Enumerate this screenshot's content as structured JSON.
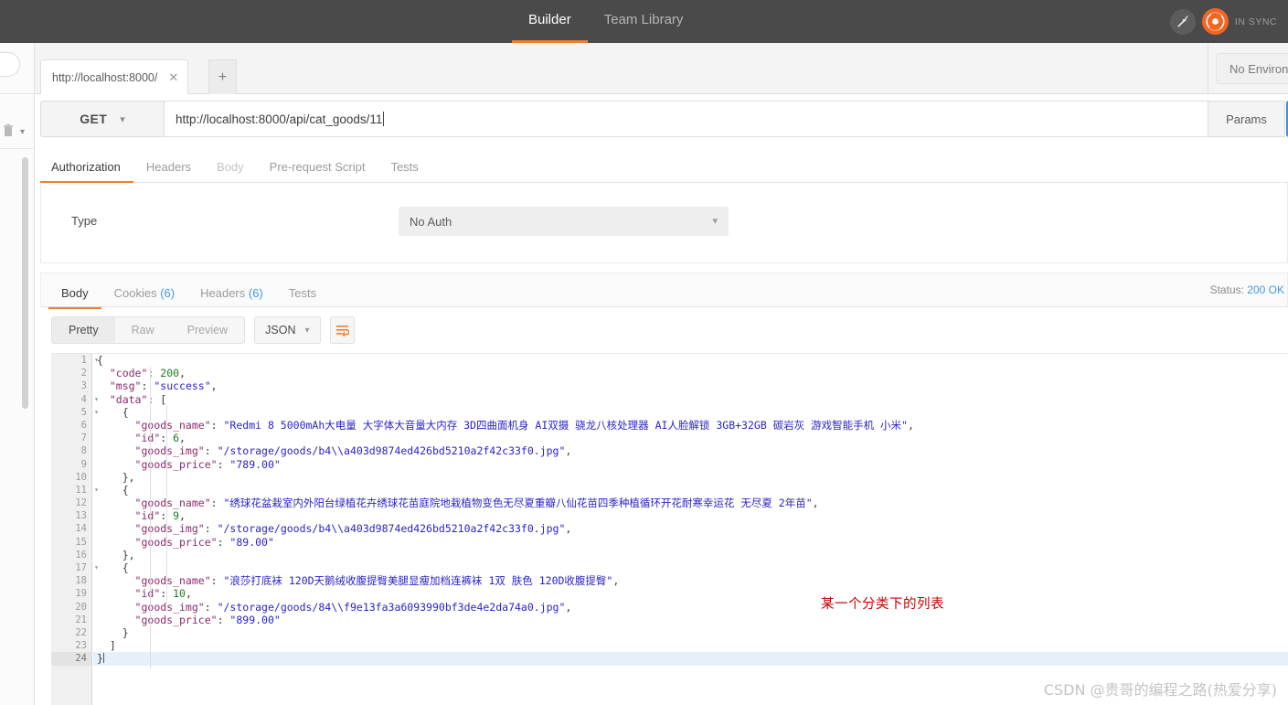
{
  "topbar": {
    "nav": [
      {
        "label": "Builder",
        "active": true
      },
      {
        "label": "Team Library",
        "active": false
      }
    ],
    "dish_icon": "satellite-dish-icon",
    "sync_icon": "postman-sync-icon",
    "sync_label": "IN SYNC",
    "accent_color": "#ef7f2f",
    "background_color": "#4a4a4a"
  },
  "tabstrip": {
    "request_tab_label": "http://localhost:8000/",
    "close_icon": "close-icon",
    "new_tab_icon": "plus-icon",
    "environment_label": "No Environment"
  },
  "request": {
    "method": "GET",
    "method_chevron": "chevron-down-icon",
    "url": "http://localhost:8000/api/cat_goods/11",
    "params_label": "Params",
    "send_button_color": "#3f9ae5",
    "tabs": [
      {
        "label": "Authorization",
        "active": true,
        "dim": false
      },
      {
        "label": "Headers",
        "active": false,
        "dim": false
      },
      {
        "label": "Body",
        "active": false,
        "dim": true
      },
      {
        "label": "Pre-request Script",
        "active": false,
        "dim": false
      },
      {
        "label": "Tests",
        "active": false,
        "dim": false
      }
    ],
    "auth": {
      "type_label": "Type",
      "type_value": "No Auth",
      "chevron": "chevron-down-icon"
    }
  },
  "response": {
    "tabs": [
      {
        "label": "Body",
        "count": "",
        "active": true
      },
      {
        "label": "Cookies",
        "count": "(6)",
        "active": false
      },
      {
        "label": "Headers",
        "count": "(6)",
        "active": false
      },
      {
        "label": "Tests",
        "count": "",
        "active": false
      }
    ],
    "status_label": "Status:",
    "status_value": "200 OK",
    "view_modes": [
      {
        "label": "Pretty",
        "active": true
      },
      {
        "label": "Raw",
        "active": false
      },
      {
        "label": "Preview",
        "active": false
      }
    ],
    "format": "JSON",
    "format_chevron": "chevron-down-icon",
    "wrap_icon": "word-wrap-icon",
    "code_lines": [
      {
        "n": 1,
        "fold": true,
        "current": false,
        "tokens": [
          {
            "t": "{",
            "c": "p"
          }
        ]
      },
      {
        "n": 2,
        "fold": false,
        "current": false,
        "tokens": [
          {
            "t": "  ",
            "c": "p"
          },
          {
            "t": "\"code\"",
            "c": "k"
          },
          {
            "t": ": ",
            "c": "p"
          },
          {
            "t": "200",
            "c": "n"
          },
          {
            "t": ",",
            "c": "p"
          }
        ]
      },
      {
        "n": 3,
        "fold": false,
        "current": false,
        "tokens": [
          {
            "t": "  ",
            "c": "p"
          },
          {
            "t": "\"msg\"",
            "c": "k"
          },
          {
            "t": ": ",
            "c": "p"
          },
          {
            "t": "\"success\"",
            "c": "s"
          },
          {
            "t": ",",
            "c": "p"
          }
        ]
      },
      {
        "n": 4,
        "fold": true,
        "current": false,
        "tokens": [
          {
            "t": "  ",
            "c": "p"
          },
          {
            "t": "\"data\"",
            "c": "k"
          },
          {
            "t": ": [",
            "c": "p"
          }
        ]
      },
      {
        "n": 5,
        "fold": true,
        "current": false,
        "tokens": [
          {
            "t": "    {",
            "c": "p"
          }
        ]
      },
      {
        "n": 6,
        "fold": false,
        "current": false,
        "tokens": [
          {
            "t": "      ",
            "c": "p"
          },
          {
            "t": "\"goods_name\"",
            "c": "k"
          },
          {
            "t": ": ",
            "c": "p"
          },
          {
            "t": "\"Redmi 8 5000mAh大电量 大字体大音量大内存 3D四曲面机身 AI双摄 骁龙八核处理器 AI人脸解锁 3GB+32GB 碳岩灰 游戏智能手机 小米\"",
            "c": "s"
          },
          {
            "t": ",",
            "c": "p"
          }
        ]
      },
      {
        "n": 7,
        "fold": false,
        "current": false,
        "tokens": [
          {
            "t": "      ",
            "c": "p"
          },
          {
            "t": "\"id\"",
            "c": "k"
          },
          {
            "t": ": ",
            "c": "p"
          },
          {
            "t": "6",
            "c": "n"
          },
          {
            "t": ",",
            "c": "p"
          }
        ]
      },
      {
        "n": 8,
        "fold": false,
        "current": false,
        "tokens": [
          {
            "t": "      ",
            "c": "p"
          },
          {
            "t": "\"goods_img\"",
            "c": "k"
          },
          {
            "t": ": ",
            "c": "p"
          },
          {
            "t": "\"/storage/goods/b4\\\\a403d9874ed426bd5210a2f42c33f0.jpg\"",
            "c": "s"
          },
          {
            "t": ",",
            "c": "p"
          }
        ]
      },
      {
        "n": 9,
        "fold": false,
        "current": false,
        "tokens": [
          {
            "t": "      ",
            "c": "p"
          },
          {
            "t": "\"goods_price\"",
            "c": "k"
          },
          {
            "t": ": ",
            "c": "p"
          },
          {
            "t": "\"789.00\"",
            "c": "s"
          }
        ]
      },
      {
        "n": 10,
        "fold": false,
        "current": false,
        "tokens": [
          {
            "t": "    },",
            "c": "p"
          }
        ]
      },
      {
        "n": 11,
        "fold": true,
        "current": false,
        "tokens": [
          {
            "t": "    {",
            "c": "p"
          }
        ]
      },
      {
        "n": 12,
        "fold": false,
        "current": false,
        "tokens": [
          {
            "t": "      ",
            "c": "p"
          },
          {
            "t": "\"goods_name\"",
            "c": "k"
          },
          {
            "t": ": ",
            "c": "p"
          },
          {
            "t": "\"绣球花盆栽室内外阳台绿植花卉绣球花苗庭院地栽植物变色无尽夏重瓣八仙花苗四季种植循环开花耐寒幸运花 无尽夏 2年苗\"",
            "c": "s"
          },
          {
            "t": ",",
            "c": "p"
          }
        ]
      },
      {
        "n": 13,
        "fold": false,
        "current": false,
        "tokens": [
          {
            "t": "      ",
            "c": "p"
          },
          {
            "t": "\"id\"",
            "c": "k"
          },
          {
            "t": ": ",
            "c": "p"
          },
          {
            "t": "9",
            "c": "n"
          },
          {
            "t": ",",
            "c": "p"
          }
        ]
      },
      {
        "n": 14,
        "fold": false,
        "current": false,
        "tokens": [
          {
            "t": "      ",
            "c": "p"
          },
          {
            "t": "\"goods_img\"",
            "c": "k"
          },
          {
            "t": ": ",
            "c": "p"
          },
          {
            "t": "\"/storage/goods/b4\\\\a403d9874ed426bd5210a2f42c33f0.jpg\"",
            "c": "s"
          },
          {
            "t": ",",
            "c": "p"
          }
        ]
      },
      {
        "n": 15,
        "fold": false,
        "current": false,
        "tokens": [
          {
            "t": "      ",
            "c": "p"
          },
          {
            "t": "\"goods_price\"",
            "c": "k"
          },
          {
            "t": ": ",
            "c": "p"
          },
          {
            "t": "\"89.00\"",
            "c": "s"
          }
        ]
      },
      {
        "n": 16,
        "fold": false,
        "current": false,
        "tokens": [
          {
            "t": "    },",
            "c": "p"
          }
        ]
      },
      {
        "n": 17,
        "fold": true,
        "current": false,
        "tokens": [
          {
            "t": "    {",
            "c": "p"
          }
        ]
      },
      {
        "n": 18,
        "fold": false,
        "current": false,
        "tokens": [
          {
            "t": "      ",
            "c": "p"
          },
          {
            "t": "\"goods_name\"",
            "c": "k"
          },
          {
            "t": ": ",
            "c": "p"
          },
          {
            "t": "\"浪莎打底袜 120D天鹅绒收腹提臀美腿显瘦加档连裤袜 1双 肤色 120D收腹提臀\"",
            "c": "s"
          },
          {
            "t": ",",
            "c": "p"
          }
        ]
      },
      {
        "n": 19,
        "fold": false,
        "current": false,
        "tokens": [
          {
            "t": "      ",
            "c": "p"
          },
          {
            "t": "\"id\"",
            "c": "k"
          },
          {
            "t": ": ",
            "c": "p"
          },
          {
            "t": "10",
            "c": "n"
          },
          {
            "t": ",",
            "c": "p"
          }
        ]
      },
      {
        "n": 20,
        "fold": false,
        "current": false,
        "tokens": [
          {
            "t": "      ",
            "c": "p"
          },
          {
            "t": "\"goods_img\"",
            "c": "k"
          },
          {
            "t": ": ",
            "c": "p"
          },
          {
            "t": "\"/storage/goods/84\\\\f9e13fa3a6093990bf3de4e2da74a0.jpg\"",
            "c": "s"
          },
          {
            "t": ",",
            "c": "p"
          }
        ]
      },
      {
        "n": 21,
        "fold": false,
        "current": false,
        "tokens": [
          {
            "t": "      ",
            "c": "p"
          },
          {
            "t": "\"goods_price\"",
            "c": "k"
          },
          {
            "t": ": ",
            "c": "p"
          },
          {
            "t": "\"899.00\"",
            "c": "s"
          }
        ]
      },
      {
        "n": 22,
        "fold": false,
        "current": false,
        "tokens": [
          {
            "t": "    }",
            "c": "p"
          }
        ]
      },
      {
        "n": 23,
        "fold": false,
        "current": false,
        "tokens": [
          {
            "t": "  ]",
            "c": "p"
          }
        ]
      },
      {
        "n": 24,
        "fold": false,
        "current": true,
        "tokens": [
          {
            "t": "}",
            "c": "p"
          }
        ]
      }
    ]
  },
  "annotation": {
    "text": "某一个分类下的列表",
    "color": "#cc0000"
  },
  "watermark": {
    "text": "CSDN @贵哥的编程之路(热爱分享)"
  },
  "sidebar": {
    "search_field": "",
    "trash_icon": "trash-icon",
    "chevron_icon": "chevron-down-icon"
  }
}
